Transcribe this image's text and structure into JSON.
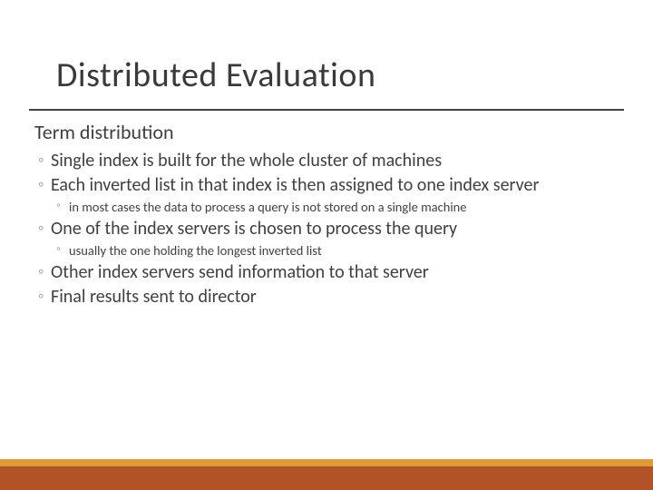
{
  "title": "Distributed Evaluation",
  "section_heading": "Term distribution",
  "bullets": [
    {
      "level": 1,
      "text": "Single index is built for the whole cluster of machines"
    },
    {
      "level": 1,
      "text": "Each inverted list in that index is then assigned to one index server"
    },
    {
      "level": 2,
      "text": "in most cases the data to process a query is not stored on a single machine"
    },
    {
      "level": 1,
      "text": "One of the index servers is chosen to process the query"
    },
    {
      "level": 2,
      "text": "usually the one holding the longest inverted list"
    },
    {
      "level": 1,
      "text": "Other index servers send information to that server"
    },
    {
      "level": 1,
      "text": "Final results sent to director"
    }
  ],
  "colors": {
    "footer_top": "#e09a3a",
    "footer_bottom": "#b15326",
    "text": "#404040"
  }
}
